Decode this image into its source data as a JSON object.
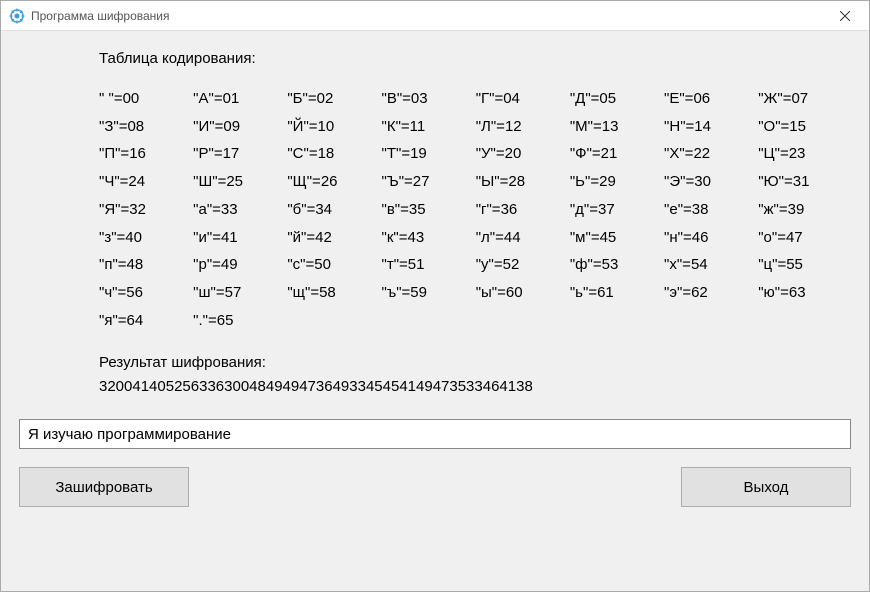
{
  "window": {
    "title": "Программа шифрования"
  },
  "main": {
    "heading": "Таблица кодирования:",
    "table": [
      [
        "\" \"=00",
        "\"А\"=01",
        "\"Б\"=02",
        "\"В\"=03",
        "\"Г\"=04",
        "\"Д\"=05",
        "\"Е\"=06",
        "\"Ж\"=07"
      ],
      [
        "\"З\"=08",
        "\"И\"=09",
        "\"Й\"=10",
        "\"К\"=11",
        "\"Л\"=12",
        "\"М\"=13",
        "\"Н\"=14",
        "\"О\"=15"
      ],
      [
        "\"П\"=16",
        "\"Р\"=17",
        "\"С\"=18",
        "\"Т\"=19",
        "\"У\"=20",
        "\"Ф\"=21",
        "\"Х\"=22",
        "\"Ц\"=23"
      ],
      [
        "\"Ч\"=24",
        "\"Ш\"=25",
        "\"Щ\"=26",
        "\"Ъ\"=27",
        "\"Ы\"=28",
        "\"Ь\"=29",
        "\"Э\"=30",
        "\"Ю\"=31"
      ],
      [
        "\"Я\"=32",
        "\"а\"=33",
        "\"б\"=34",
        "\"в\"=35",
        "\"г\"=36",
        "\"д\"=37",
        "\"е\"=38",
        "\"ж\"=39"
      ],
      [
        "\"з\"=40",
        "\"и\"=41",
        "\"й\"=42",
        "\"к\"=43",
        "\"л\"=44",
        "\"м\"=45",
        "\"н\"=46",
        "\"о\"=47"
      ],
      [
        "\"п\"=48",
        "\"р\"=49",
        "\"с\"=50",
        "\"т\"=51",
        "\"у\"=52",
        "\"ф\"=53",
        "\"х\"=54",
        "\"ц\"=55"
      ],
      [
        "\"ч\"=56",
        "\"ш\"=57",
        "\"щ\"=58",
        "\"ъ\"=59",
        "\"ы\"=60",
        "\"ь\"=61",
        "\"э\"=62",
        "\"ю\"=63"
      ],
      [
        "\"я\"=64",
        "\".\"=65"
      ]
    ],
    "result_label": "Результат шифрования:",
    "result_value": "320041405256336300484949473649334545414947353346 4138",
    "input_value": "Я изучаю программирование",
    "encrypt_button": "Зашифровать",
    "exit_button": "Выход"
  }
}
